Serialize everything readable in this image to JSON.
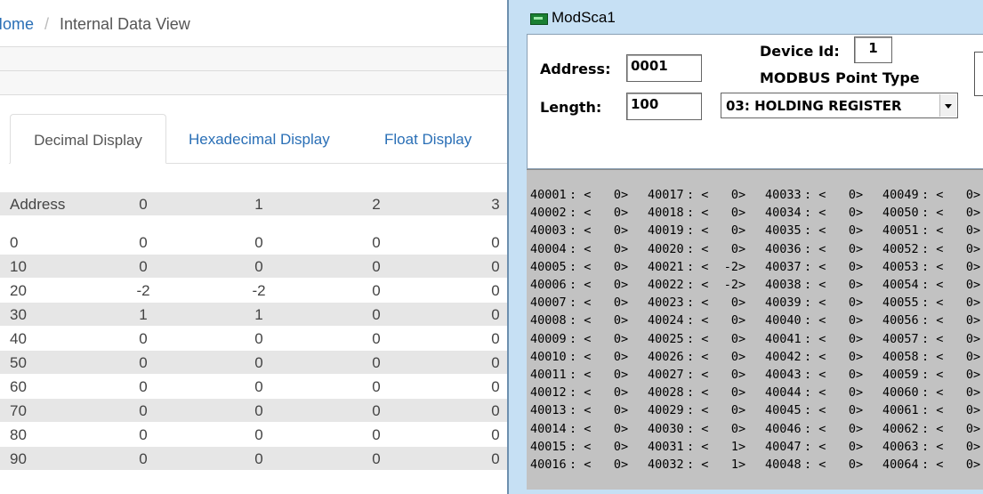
{
  "breadcrumb": {
    "home": "Home",
    "current": "Internal Data View"
  },
  "tabs": [
    "Decimal Display",
    "Hexadecimal Display",
    "Float Display"
  ],
  "table": {
    "headers": [
      "Address",
      "0",
      "1",
      "2",
      "3"
    ],
    "rows": [
      [
        "0",
        "0",
        "0",
        "0",
        "0"
      ],
      [
        "10",
        "0",
        "0",
        "0",
        "0"
      ],
      [
        "20",
        "-2",
        "-2",
        "0",
        "0"
      ],
      [
        "30",
        "1",
        "1",
        "0",
        "0"
      ],
      [
        "40",
        "0",
        "0",
        "0",
        "0"
      ],
      [
        "50",
        "0",
        "0",
        "0",
        "0"
      ],
      [
        "60",
        "0",
        "0",
        "0",
        "0"
      ],
      [
        "70",
        "0",
        "0",
        "0",
        "0"
      ],
      [
        "80",
        "0",
        "0",
        "0",
        "0"
      ],
      [
        "90",
        "0",
        "0",
        "0",
        "0"
      ]
    ]
  },
  "modscan": {
    "title": "ModSca1",
    "address_label": "Address:",
    "address_value": "0001",
    "length_label": "Length:",
    "length_value": "100",
    "device_id_label": "Device Id:",
    "device_id_value": "1",
    "point_type_label": "MODBUS Point Type",
    "point_type_value": "03: HOLDING REGISTER",
    "registers": [
      [
        "40001",
        "0"
      ],
      [
        "40002",
        "0"
      ],
      [
        "40003",
        "0"
      ],
      [
        "40004",
        "0"
      ],
      [
        "40005",
        "0"
      ],
      [
        "40006",
        "0"
      ],
      [
        "40007",
        "0"
      ],
      [
        "40008",
        "0"
      ],
      [
        "40009",
        "0"
      ],
      [
        "40010",
        "0"
      ],
      [
        "40011",
        "0"
      ],
      [
        "40012",
        "0"
      ],
      [
        "40013",
        "0"
      ],
      [
        "40014",
        "0"
      ],
      [
        "40015",
        "0"
      ],
      [
        "40016",
        "0"
      ],
      [
        "40017",
        "0"
      ],
      [
        "40018",
        "0"
      ],
      [
        "40019",
        "0"
      ],
      [
        "40020",
        "0"
      ],
      [
        "40021",
        "-2"
      ],
      [
        "40022",
        "-2"
      ],
      [
        "40023",
        "0"
      ],
      [
        "40024",
        "0"
      ],
      [
        "40025",
        "0"
      ],
      [
        "40026",
        "0"
      ],
      [
        "40027",
        "0"
      ],
      [
        "40028",
        "0"
      ],
      [
        "40029",
        "0"
      ],
      [
        "40030",
        "0"
      ],
      [
        "40031",
        "1"
      ],
      [
        "40032",
        "1"
      ],
      [
        "40033",
        "0"
      ],
      [
        "40034",
        "0"
      ],
      [
        "40035",
        "0"
      ],
      [
        "40036",
        "0"
      ],
      [
        "40037",
        "0"
      ],
      [
        "40038",
        "0"
      ],
      [
        "40039",
        "0"
      ],
      [
        "40040",
        "0"
      ],
      [
        "40041",
        "0"
      ],
      [
        "40042",
        "0"
      ],
      [
        "40043",
        "0"
      ],
      [
        "40044",
        "0"
      ],
      [
        "40045",
        "0"
      ],
      [
        "40046",
        "0"
      ],
      [
        "40047",
        "0"
      ],
      [
        "40048",
        "0"
      ],
      [
        "40049",
        "0"
      ],
      [
        "40050",
        "0"
      ],
      [
        "40051",
        "0"
      ],
      [
        "40052",
        "0"
      ],
      [
        "40053",
        "0"
      ],
      [
        "40054",
        "0"
      ],
      [
        "40055",
        "0"
      ],
      [
        "40056",
        "0"
      ],
      [
        "40057",
        "0"
      ],
      [
        "40058",
        "0"
      ],
      [
        "40059",
        "0"
      ],
      [
        "40060",
        "0"
      ],
      [
        "40061",
        "0"
      ],
      [
        "40062",
        "0"
      ],
      [
        "40063",
        "0"
      ],
      [
        "40064",
        "0"
      ]
    ]
  },
  "colors": {
    "link": "#2a6fb6",
    "row_shade": "#e6e6e6",
    "data_bg": "#c2c2c2",
    "window_frame": "#c6e0f4"
  }
}
